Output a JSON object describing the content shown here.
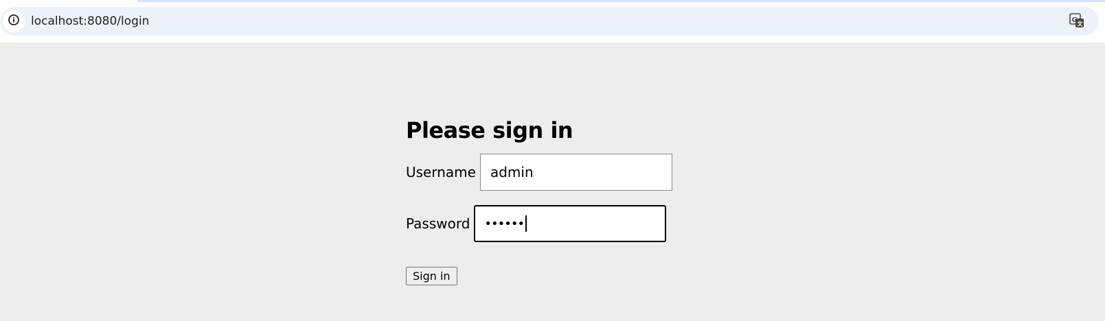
{
  "browser": {
    "url": "localhost:8080/login",
    "site_info_icon": "info-circle-icon",
    "translate_icon": "google-translate-icon"
  },
  "login": {
    "heading": "Please sign in",
    "username_label": "Username",
    "username_value": "admin",
    "password_label": "Password",
    "password_masked": "••••••",
    "submit_label": "Sign in"
  },
  "colors": {
    "page_background": "#ededed",
    "omnibox_background": "#edf2fa",
    "input_border": "#8a8a8a",
    "focus_border": "#000000"
  }
}
